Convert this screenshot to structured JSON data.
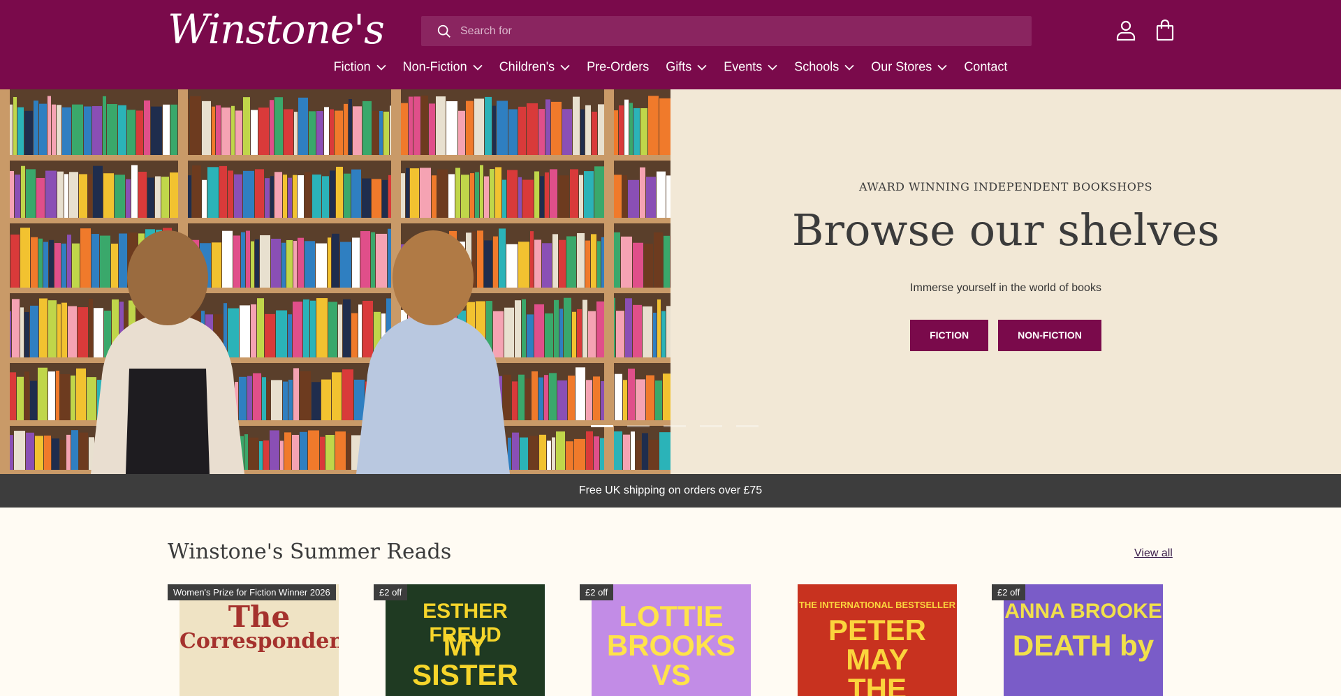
{
  "header": {
    "logo": "Winstone's",
    "search_placeholder": "Search for"
  },
  "nav": [
    {
      "label": "Fiction",
      "dropdown": true
    },
    {
      "label": "Non-Fiction",
      "dropdown": true
    },
    {
      "label": "Children's",
      "dropdown": true
    },
    {
      "label": "Pre-Orders",
      "dropdown": false
    },
    {
      "label": "Gifts",
      "dropdown": true
    },
    {
      "label": "Events",
      "dropdown": true
    },
    {
      "label": "Schools",
      "dropdown": true
    },
    {
      "label": "Our Stores",
      "dropdown": true
    },
    {
      "label": "Contact",
      "dropdown": false
    }
  ],
  "hero": {
    "eyebrow": "AWARD WINNING INDEPENDENT BOOKSHOPS",
    "title": "Browse our shelves",
    "subtitle": "Immerse yourself in the world of books",
    "btn_fiction": "FICTION",
    "btn_nonfiction": "NON-FICTION",
    "slides": 5,
    "active_slide": 1
  },
  "shipping": "Free UK shipping on orders over £75",
  "summer": {
    "title": "Winstone's Summer Reads",
    "view_all": "View all",
    "books": [
      {
        "badge": "Women's Prize for Fiction Winner 2026",
        "cover_lines": [
          "The",
          "Correspondent"
        ],
        "bg": "#efe3c4",
        "fg": "#a5322d"
      },
      {
        "badge": "£2 off",
        "cover_lines": [
          "ESTHER FREUD",
          "MY",
          "SISTER"
        ],
        "bg": "#1f3a22",
        "fg": "#f6d52b"
      },
      {
        "badge": "£2 off",
        "cover_lines": [
          "LOTTIE",
          "BROOKS",
          "VS"
        ],
        "bg": "#c28ce6",
        "fg": "#ffe34a"
      },
      {
        "badge": "",
        "cover_lines": [
          "THE INTERNATIONAL BESTSELLER",
          "PETER",
          "MAY",
          "THE"
        ],
        "bg": "#c8321f",
        "fg": "#fbd53d"
      },
      {
        "badge": "£2 off",
        "cover_lines": [
          "ANNA BROOKE",
          "DEATH by"
        ],
        "bg": "#7a5cc8",
        "fg": "#f1e04a"
      }
    ]
  },
  "colors": {
    "brand": "#7a0a4b",
    "hero_bg": "#f2e8d6",
    "strip": "#3d3d3d"
  }
}
